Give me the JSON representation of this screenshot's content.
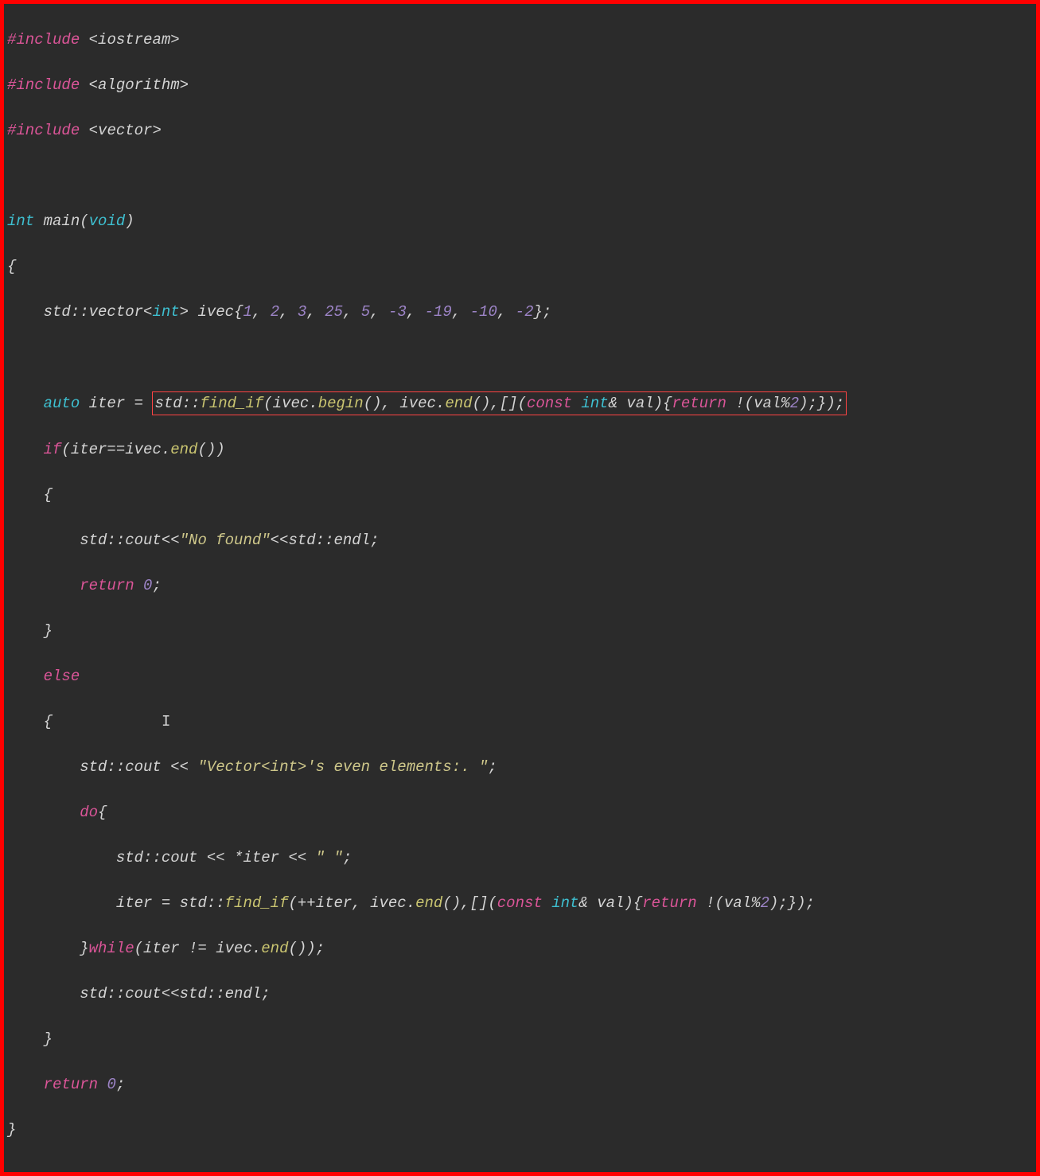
{
  "code": {
    "l1": {
      "hash": "#",
      "include": "include",
      "header": "<iostream>"
    },
    "l2": {
      "hash": "#",
      "include": "include",
      "header": "<algorithm>"
    },
    "l3": {
      "hash": "#",
      "include": "include",
      "header": "<vector>"
    },
    "l5": {
      "int": "int",
      "main": " main(",
      "void": "void",
      "end": ")"
    },
    "l6": "{",
    "l7": {
      "pre": "    std::vector<",
      "int": "int",
      "mid": "> ivec{",
      "n1": "1",
      "c1": ", ",
      "n2": "2",
      "c2": ", ",
      "n3": "3",
      "c3": ", ",
      "n4": "25",
      "c4": ", ",
      "n5": "5",
      "c5": ", ",
      "n6": "-3",
      "c6": ", ",
      "n7": "-19",
      "c7": ", ",
      "n8": "-10",
      "c8": ", ",
      "n9": "-2",
      "end": "};"
    },
    "l9": {
      "pre": "    ",
      "auto": "auto",
      "mid": " iter = ",
      "boxpre": "std::",
      "fn": "find_if",
      "paren1": "(ivec.",
      "begin": "begin",
      "paren2": "(), ivec.",
      "end": "end",
      "paren3": "(),[](",
      "const": "const",
      "sp1": " ",
      "int": "int",
      "amp": "& val){",
      "ret": "return",
      "expr": " !(val%",
      "two": "2",
      "close": ");});"
    },
    "l10": {
      "pre": "    ",
      "if": "if",
      "mid": "(iter==ivec.",
      "end": "end",
      "close": "())"
    },
    "l11": "    {",
    "l12": {
      "pre": "        std::cout<<",
      "str": "\"No found\"",
      "post": "<<std::endl;"
    },
    "l13": {
      "pre": "        ",
      "ret": "return",
      "sp": " ",
      "zero": "0",
      "semi": ";"
    },
    "l14": "    }",
    "l15": {
      "pre": "    ",
      "else": "else"
    },
    "l16": "    {",
    "l17": {
      "pre": "        std::cout << ",
      "str": "\"Vector<int>'s even elements:. \"",
      "semi": ";"
    },
    "l18": {
      "pre": "        ",
      "do": "do",
      "brace": "{"
    },
    "l19": {
      "pre": "            std::cout << *iter << ",
      "str": "\" \"",
      "semi": ";"
    },
    "l20": {
      "pre": "            iter = std::",
      "fn": "find_if",
      "paren1": "(++iter, ivec.",
      "end": "end",
      "paren2": "(),[](",
      "const": "const",
      "sp": " ",
      "int": "int",
      "amp": "& val){",
      "ret": "return",
      "expr": " !(val%",
      "two": "2",
      "close": ");});"
    },
    "l21": {
      "pre": "        }",
      "while": "while",
      "mid": "(iter != ivec.",
      "end": "end",
      "close": "());"
    },
    "l22": "        std::cout<<std::endl;",
    "l23": "    }",
    "l24": {
      "pre": "    ",
      "ret": "return",
      "sp": " ",
      "zero": "0",
      "semi": ";"
    },
    "l25": "}"
  },
  "cursor_glyph": "I"
}
